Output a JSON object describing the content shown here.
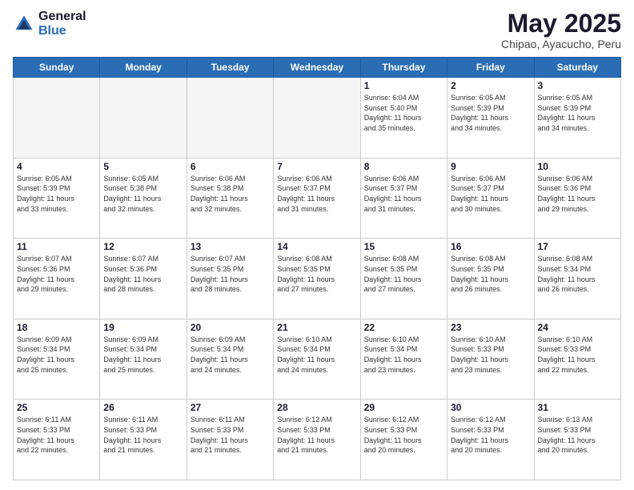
{
  "logo": {
    "general": "General",
    "blue": "Blue"
  },
  "header": {
    "month": "May 2025",
    "location": "Chipao, Ayacucho, Peru"
  },
  "weekdays": [
    "Sunday",
    "Monday",
    "Tuesday",
    "Wednesday",
    "Thursday",
    "Friday",
    "Saturday"
  ],
  "weeks": [
    [
      {
        "day": "",
        "empty": true
      },
      {
        "day": "",
        "empty": true
      },
      {
        "day": "",
        "empty": true
      },
      {
        "day": "",
        "empty": true
      },
      {
        "day": "1",
        "line1": "Sunrise: 6:04 AM",
        "line2": "Sunset: 5:40 PM",
        "line3": "Daylight: 11 hours",
        "line4": "and 35 minutes."
      },
      {
        "day": "2",
        "line1": "Sunrise: 6:05 AM",
        "line2": "Sunset: 5:39 PM",
        "line3": "Daylight: 11 hours",
        "line4": "and 34 minutes."
      },
      {
        "day": "3",
        "line1": "Sunrise: 6:05 AM",
        "line2": "Sunset: 5:39 PM",
        "line3": "Daylight: 11 hours",
        "line4": "and 34 minutes."
      }
    ],
    [
      {
        "day": "4",
        "line1": "Sunrise: 6:05 AM",
        "line2": "Sunset: 5:39 PM",
        "line3": "Daylight: 11 hours",
        "line4": "and 33 minutes."
      },
      {
        "day": "5",
        "line1": "Sunrise: 6:05 AM",
        "line2": "Sunset: 5:38 PM",
        "line3": "Daylight: 11 hours",
        "line4": "and 32 minutes."
      },
      {
        "day": "6",
        "line1": "Sunrise: 6:06 AM",
        "line2": "Sunset: 5:38 PM",
        "line3": "Daylight: 11 hours",
        "line4": "and 32 minutes."
      },
      {
        "day": "7",
        "line1": "Sunrise: 6:06 AM",
        "line2": "Sunset: 5:37 PM",
        "line3": "Daylight: 11 hours",
        "line4": "and 31 minutes."
      },
      {
        "day": "8",
        "line1": "Sunrise: 6:06 AM",
        "line2": "Sunset: 5:37 PM",
        "line3": "Daylight: 11 hours",
        "line4": "and 31 minutes."
      },
      {
        "day": "9",
        "line1": "Sunrise: 6:06 AM",
        "line2": "Sunset: 5:37 PM",
        "line3": "Daylight: 11 hours",
        "line4": "and 30 minutes."
      },
      {
        "day": "10",
        "line1": "Sunrise: 6:06 AM",
        "line2": "Sunset: 5:36 PM",
        "line3": "Daylight: 11 hours",
        "line4": "and 29 minutes."
      }
    ],
    [
      {
        "day": "11",
        "line1": "Sunrise: 6:07 AM",
        "line2": "Sunset: 5:36 PM",
        "line3": "Daylight: 11 hours",
        "line4": "and 29 minutes."
      },
      {
        "day": "12",
        "line1": "Sunrise: 6:07 AM",
        "line2": "Sunset: 5:36 PM",
        "line3": "Daylight: 11 hours",
        "line4": "and 28 minutes."
      },
      {
        "day": "13",
        "line1": "Sunrise: 6:07 AM",
        "line2": "Sunset: 5:35 PM",
        "line3": "Daylight: 11 hours",
        "line4": "and 28 minutes."
      },
      {
        "day": "14",
        "line1": "Sunrise: 6:08 AM",
        "line2": "Sunset: 5:35 PM",
        "line3": "Daylight: 11 hours",
        "line4": "and 27 minutes."
      },
      {
        "day": "15",
        "line1": "Sunrise: 6:08 AM",
        "line2": "Sunset: 5:35 PM",
        "line3": "Daylight: 11 hours",
        "line4": "and 27 minutes."
      },
      {
        "day": "16",
        "line1": "Sunrise: 6:08 AM",
        "line2": "Sunset: 5:35 PM",
        "line3": "Daylight: 11 hours",
        "line4": "and 26 minutes."
      },
      {
        "day": "17",
        "line1": "Sunrise: 6:08 AM",
        "line2": "Sunset: 5:34 PM",
        "line3": "Daylight: 11 hours",
        "line4": "and 26 minutes."
      }
    ],
    [
      {
        "day": "18",
        "line1": "Sunrise: 6:09 AM",
        "line2": "Sunset: 5:34 PM",
        "line3": "Daylight: 11 hours",
        "line4": "and 25 minutes."
      },
      {
        "day": "19",
        "line1": "Sunrise: 6:09 AM",
        "line2": "Sunset: 5:34 PM",
        "line3": "Daylight: 11 hours",
        "line4": "and 25 minutes."
      },
      {
        "day": "20",
        "line1": "Sunrise: 6:09 AM",
        "line2": "Sunset: 5:34 PM",
        "line3": "Daylight: 11 hours",
        "line4": "and 24 minutes."
      },
      {
        "day": "21",
        "line1": "Sunrise: 6:10 AM",
        "line2": "Sunset: 5:34 PM",
        "line3": "Daylight: 11 hours",
        "line4": "and 24 minutes."
      },
      {
        "day": "22",
        "line1": "Sunrise: 6:10 AM",
        "line2": "Sunset: 5:34 PM",
        "line3": "Daylight: 11 hours",
        "line4": "and 23 minutes."
      },
      {
        "day": "23",
        "line1": "Sunrise: 6:10 AM",
        "line2": "Sunset: 5:33 PM",
        "line3": "Daylight: 11 hours",
        "line4": "and 23 minutes."
      },
      {
        "day": "24",
        "line1": "Sunrise: 6:10 AM",
        "line2": "Sunset: 5:33 PM",
        "line3": "Daylight: 11 hours",
        "line4": "and 22 minutes."
      }
    ],
    [
      {
        "day": "25",
        "line1": "Sunrise: 6:11 AM",
        "line2": "Sunset: 5:33 PM",
        "line3": "Daylight: 11 hours",
        "line4": "and 22 minutes."
      },
      {
        "day": "26",
        "line1": "Sunrise: 6:11 AM",
        "line2": "Sunset: 5:33 PM",
        "line3": "Daylight: 11 hours",
        "line4": "and 21 minutes."
      },
      {
        "day": "27",
        "line1": "Sunrise: 6:11 AM",
        "line2": "Sunset: 5:33 PM",
        "line3": "Daylight: 11 hours",
        "line4": "and 21 minutes."
      },
      {
        "day": "28",
        "line1": "Sunrise: 6:12 AM",
        "line2": "Sunset: 5:33 PM",
        "line3": "Daylight: 11 hours",
        "line4": "and 21 minutes."
      },
      {
        "day": "29",
        "line1": "Sunrise: 6:12 AM",
        "line2": "Sunset: 5:33 PM",
        "line3": "Daylight: 11 hours",
        "line4": "and 20 minutes."
      },
      {
        "day": "30",
        "line1": "Sunrise: 6:12 AM",
        "line2": "Sunset: 5:33 PM",
        "line3": "Daylight: 11 hours",
        "line4": "and 20 minutes."
      },
      {
        "day": "31",
        "line1": "Sunrise: 6:13 AM",
        "line2": "Sunset: 5:33 PM",
        "line3": "Daylight: 11 hours",
        "line4": "and 20 minutes."
      }
    ]
  ]
}
